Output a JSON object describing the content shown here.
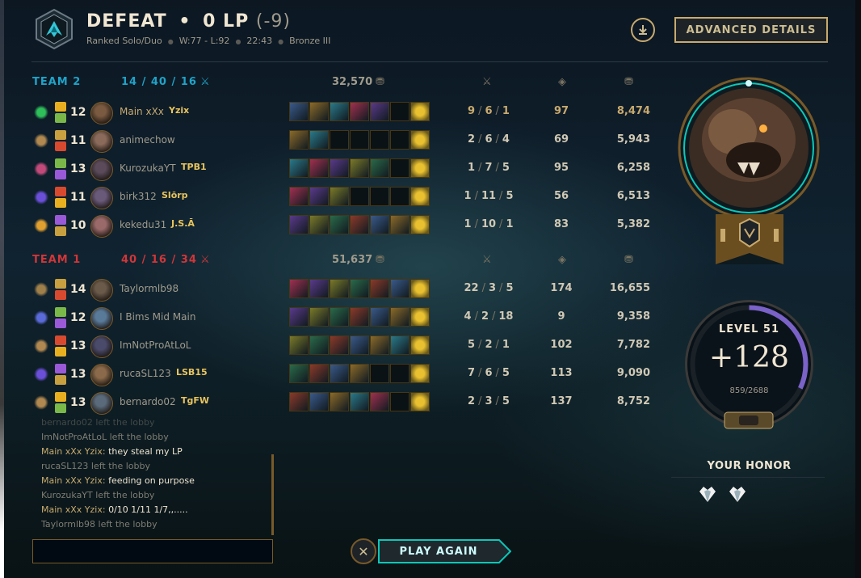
{
  "header": {
    "result": "DEFEAT",
    "lp": "0 LP",
    "lp_delta": "(-9)",
    "queue": "Ranked Solo/Duo",
    "record": "W:77 - L:92",
    "duration": "22:43",
    "rank": "Bronze III",
    "advanced_label": "ADVANCED DETAILS",
    "download_icon": "download-icon"
  },
  "teams": [
    {
      "name": "TEAM 2",
      "color": "#1fa3c8",
      "kda": "14 / 40 / 16",
      "gold": "32,570",
      "players": [
        {
          "level": "12",
          "name": "Main xXx",
          "tag": "Yzix",
          "kda": [
            "9",
            "6",
            "1"
          ],
          "cs": "97",
          "gold": "8,474",
          "self": true
        },
        {
          "level": "11",
          "name": "animechow",
          "tag": "",
          "kda": [
            "2",
            "6",
            "4"
          ],
          "cs": "69",
          "gold": "5,943",
          "self": false
        },
        {
          "level": "13",
          "name": "KurozukaYT",
          "tag": "TPB1",
          "kda": [
            "1",
            "7",
            "5"
          ],
          "cs": "95",
          "gold": "6,258",
          "self": false
        },
        {
          "level": "11",
          "name": "birk312",
          "tag": "Slōrp",
          "kda": [
            "1",
            "11",
            "5"
          ],
          "cs": "56",
          "gold": "6,513",
          "self": false
        },
        {
          "level": "10",
          "name": "kekedu31",
          "tag": "J.S.Ā",
          "kda": [
            "1",
            "10",
            "1"
          ],
          "cs": "83",
          "gold": "5,382",
          "self": false
        }
      ]
    },
    {
      "name": "TEAM 1",
      "color": "#d13639",
      "kda": "40 / 16 / 34",
      "gold": "51,637",
      "players": [
        {
          "level": "14",
          "name": "Taylormlb98",
          "tag": "",
          "kda": [
            "22",
            "3",
            "5"
          ],
          "cs": "174",
          "gold": "16,655",
          "self": false
        },
        {
          "level": "12",
          "name": "I Bims Mid Main",
          "tag": "",
          "kda": [
            "4",
            "2",
            "18"
          ],
          "cs": "9",
          "gold": "9,358",
          "self": false
        },
        {
          "level": "13",
          "name": "ImNotProAtLoL",
          "tag": "",
          "kda": [
            "5",
            "2",
            "1"
          ],
          "cs": "102",
          "gold": "7,782",
          "self": false
        },
        {
          "level": "13",
          "name": "rucaSL123",
          "tag": "LSB15",
          "kda": [
            "7",
            "6",
            "5"
          ],
          "cs": "113",
          "gold": "9,090",
          "self": false
        },
        {
          "level": "13",
          "name": "bernardo02",
          "tag": "TgFW",
          "kda": [
            "2",
            "3",
            "5"
          ],
          "cs": "137",
          "gold": "8,752",
          "self": false
        }
      ]
    }
  ],
  "chat": [
    {
      "who": "",
      "text": "bernardo02 left the lobby",
      "system": true
    },
    {
      "who": "",
      "text": "ImNotProAtLoL left the lobby",
      "system": true
    },
    {
      "who": "Main xXx Yzix:",
      "text": " they steal my LP",
      "system": false
    },
    {
      "who": "",
      "text": "rucaSL123 left the lobby",
      "system": true
    },
    {
      "who": "Main xXx Yzix:",
      "text": " feeding on purpose",
      "system": false
    },
    {
      "who": "",
      "text": "KurozukaYT left the lobby",
      "system": true
    },
    {
      "who": "Main xXx Yzix:",
      "text": " 0/10 1/11 1/7,,.....",
      "system": false
    },
    {
      "who": "",
      "text": "Taylormlb98 left the lobby",
      "system": true
    }
  ],
  "play_again": "PLAY AGAIN",
  "close_symbol": "✕",
  "progress": {
    "level_label": "LEVEL 51",
    "gain": "+128",
    "xp": "859/2688",
    "fraction": 0.32
  },
  "honor": {
    "label": "YOUR HONOR"
  },
  "colors": {
    "gold": "#c8aa6e",
    "team_blue": "#1fa3c8",
    "team_red": "#d13639"
  }
}
